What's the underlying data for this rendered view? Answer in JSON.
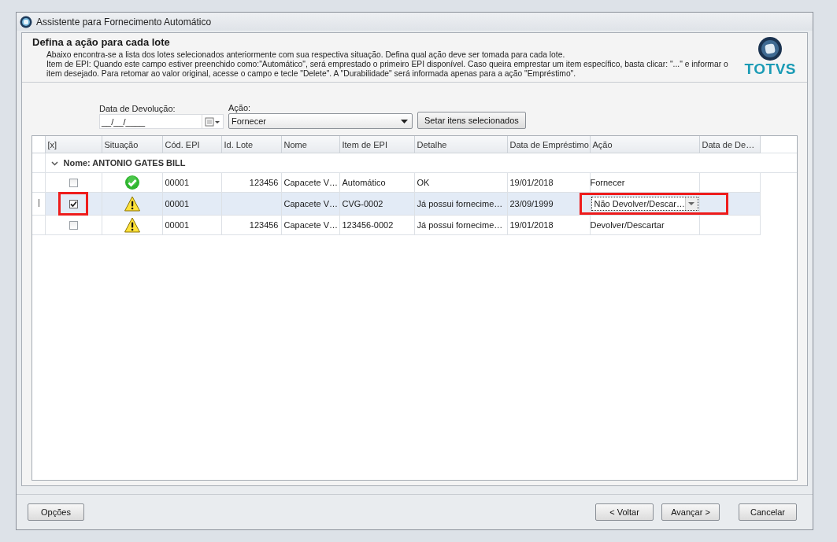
{
  "window": {
    "title": "Assistente para Fornecimento Automático"
  },
  "header": {
    "title": "Defina a ação para cada lote",
    "description": [
      "Abaixo encontra-se a lista dos lotes selecionados anteriormente com sua respectiva situação. Defina qual ação deve ser tomada para cada lote.",
      "Item de EPI: Quando este campo estiver preenchido como:\"Automático\", será emprestado o primeiro EPI disponível. Caso queira emprestar um item específico, basta clicar: \"...\" e informar o",
      "item desejado. Para retomar ao valor original, acesse o campo e tecle \"Delete\". A \"Durabilidade\" será informada apenas para a ação \"Empréstimo\"."
    ],
    "logo_text": "TOTVS"
  },
  "filters": {
    "date_label": "Data de Devolução:",
    "date_value": "__/__/____",
    "action_label": "Ação:",
    "action_value": "Fornecer",
    "apply_button": "Setar itens selecionados"
  },
  "table": {
    "columns": [
      "[x]",
      "Situação",
      "Cód. EPI",
      "Id. Lote",
      "Nome",
      "Item de EPI",
      "Detalhe",
      "Data de Empréstimo",
      "Ação",
      "Data de De…"
    ],
    "group": {
      "label": "Nome: ANTONIO GATES BILL",
      "expanded": true
    },
    "rows": [
      {
        "selected": false,
        "checked": false,
        "highlighted": false,
        "warning": false,
        "cod": "00001",
        "lote": "123456",
        "nome": "Capacete V…",
        "item": "Automático",
        "detalhe": "OK",
        "data": "19/01/2018",
        "acao": "Fornecer",
        "editing": false
      },
      {
        "selected": true,
        "checked": true,
        "highlighted": true,
        "warning": true,
        "cod": "00001",
        "lote": "",
        "nome": "Capacete V…",
        "item": "CVG-0002",
        "detalhe": "Já possui fornecime…",
        "data": "23/09/1999",
        "acao": "Não Devolver/Descar…",
        "editing": true
      },
      {
        "selected": false,
        "checked": false,
        "highlighted": false,
        "warning": true,
        "cod": "00001",
        "lote": "123456",
        "nome": "Capacete V…",
        "item": "123456-0002",
        "detalhe": "Já possui fornecime…",
        "data": "19/01/2018",
        "acao": "Devolver/Descartar",
        "editing": false
      }
    ]
  },
  "footer": {
    "options_button": "Opções",
    "buttons": [
      "< Voltar",
      "Avançar >",
      "Cancelar"
    ]
  }
}
